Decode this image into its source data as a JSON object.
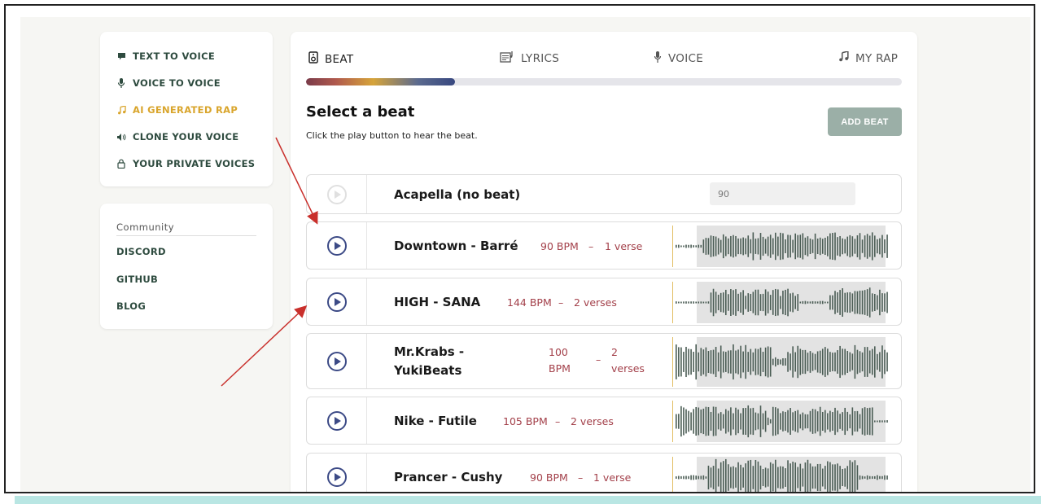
{
  "sidebar": {
    "items": [
      {
        "label": "TEXT TO VOICE",
        "icon": "chat-bubble-icon"
      },
      {
        "label": "VOICE TO VOICE",
        "icon": "microphone-icon"
      },
      {
        "label": "AI GENERATED RAP",
        "icon": "music-note-icon",
        "active": true
      },
      {
        "label": "CLONE YOUR VOICE",
        "icon": "speaker-icon"
      },
      {
        "label": "YOUR PRIVATE VOICES",
        "icon": "lock-icon"
      }
    ],
    "community": {
      "title": "Community",
      "links": [
        "DISCORD",
        "GITHUB",
        "BLOG"
      ]
    }
  },
  "steps": [
    {
      "label": "BEAT",
      "icon": "speaker-box-icon"
    },
    {
      "label": "LYRICS",
      "icon": "lyrics-icon"
    },
    {
      "label": "VOICE",
      "icon": "microphone-icon"
    },
    {
      "label": "MY RAP",
      "icon": "music-note-icon"
    }
  ],
  "progress_fraction": 0.25,
  "header": {
    "title": "Select a beat",
    "subtitle": "Click the play button to hear the beat.",
    "add_beat_label": "ADD BEAT"
  },
  "beats": [
    {
      "name": "Acapella (no beat)",
      "bpm_input_value": "90"
    },
    {
      "name": "Downtown - Barré",
      "bpm": "90 BPM",
      "sep": "–",
      "verses": "1 verse"
    },
    {
      "name": "HIGH - SANA",
      "bpm": "144 BPM",
      "sep": "–",
      "verses": "2 verses"
    },
    {
      "name_line1": "Mr.Krabs -",
      "name_line2": "YukiBeats",
      "bpm_line1": "100",
      "bpm_line2": "BPM",
      "sep": "–",
      "verses_line1": "2",
      "verses_line2": "verses"
    },
    {
      "name": "Nike - Futile",
      "bpm": "105 BPM",
      "sep": "–",
      "verses": "2 verses"
    },
    {
      "name": "Prancer - Cushy",
      "bpm": "90 BPM",
      "sep": "–",
      "verses": "1 verse"
    }
  ],
  "colors": {
    "accent_nav": "#2e4b3f",
    "active_nav": "#d9a52c",
    "play": "#3c4a86",
    "bpm_text": "#a3404a",
    "waveform": "#4a5c54",
    "waveform_bg": "#e3e3e3",
    "annotation_arrow": "#c9302c"
  }
}
